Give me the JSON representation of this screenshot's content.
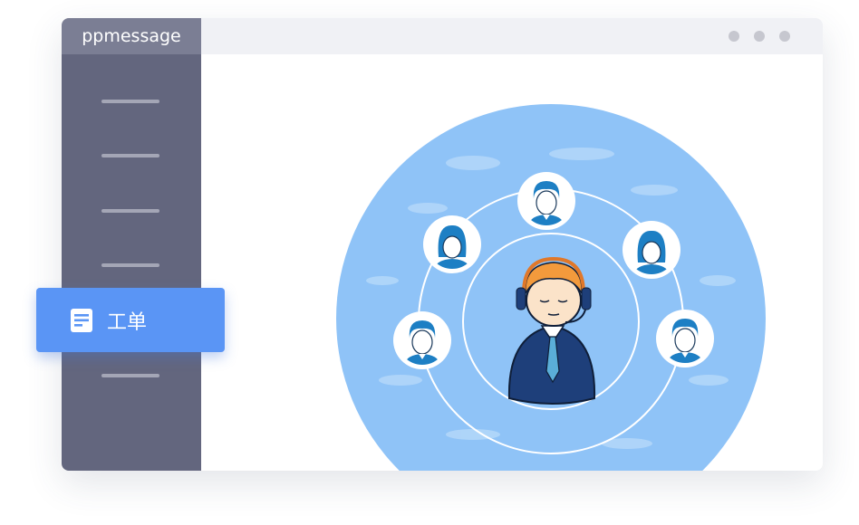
{
  "app": {
    "title": "ppmessage"
  },
  "window_controls": [
    "dot",
    "dot",
    "dot"
  ],
  "sidebar": {
    "active_item": {
      "label": "工单",
      "icon": "document-icon"
    }
  },
  "colors": {
    "accent": "#5a95f5",
    "sidebar": "#63667e",
    "title_tab": "#7b7e94",
    "illustration_circle": "#8fc3f7"
  },
  "illustration": {
    "center_figure": "support-agent-with-headset",
    "avatars": [
      "user-avatar-male",
      "user-avatar-female",
      "user-avatar-female",
      "user-avatar-male",
      "user-avatar-male"
    ]
  }
}
